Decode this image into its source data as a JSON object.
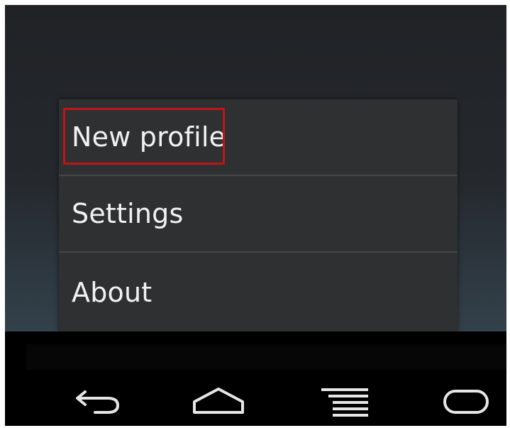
{
  "menu": {
    "items": [
      {
        "label": "New profile"
      },
      {
        "label": "Settings"
      },
      {
        "label": "About"
      }
    ]
  },
  "highlight": {
    "target": "New profile",
    "color": "#c0141b"
  },
  "nav": {
    "buttons": [
      {
        "name": "back",
        "icon": "back-arrow-icon"
      },
      {
        "name": "home",
        "icon": "home-icon"
      },
      {
        "name": "menu",
        "icon": "menu-lines-icon"
      },
      {
        "name": "recent-apps",
        "icon": "recent-apps-icon"
      }
    ]
  },
  "colors": {
    "menu_background": "#2f3031",
    "menu_divider": "#444648",
    "menu_text": "#f2f2f2",
    "nav_background": "#000000",
    "nav_icon": "#e6e6e6"
  }
}
